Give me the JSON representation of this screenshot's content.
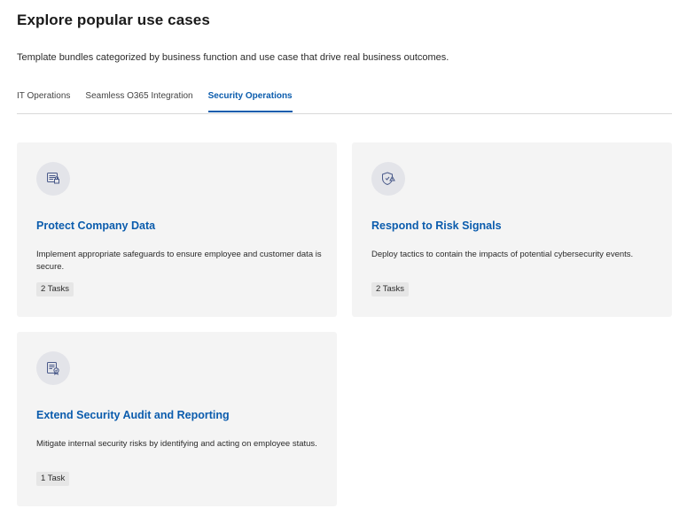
{
  "header": {
    "title": "Explore popular use cases",
    "subtitle": "Template bundles categorized by business function and use case that drive real business outcomes."
  },
  "tabs": [
    {
      "label": "IT Operations",
      "active": false
    },
    {
      "label": "Seamless O365 Integration",
      "active": false
    },
    {
      "label": "Security Operations",
      "active": true
    }
  ],
  "cards": [
    {
      "icon": "data-protection-icon",
      "title": "Protect Company Data",
      "description": "Implement appropriate safeguards to ensure employee and customer data is secure.",
      "tasks": "2 Tasks"
    },
    {
      "icon": "shield-alert-icon",
      "title": "Respond to Risk Signals",
      "description": "Deploy tactics to contain the impacts of potential cybersecurity events.",
      "tasks": "2 Tasks"
    },
    {
      "icon": "audit-report-icon",
      "title": "Extend Security Audit and Reporting",
      "description": "Mitigate internal security risks by identifying and acting on employee status.",
      "tasks": "1 Task"
    }
  ],
  "colors": {
    "accent": "#0b5cad",
    "card_background": "#f4f4f4",
    "icon_circle": "#e3e4e9"
  }
}
